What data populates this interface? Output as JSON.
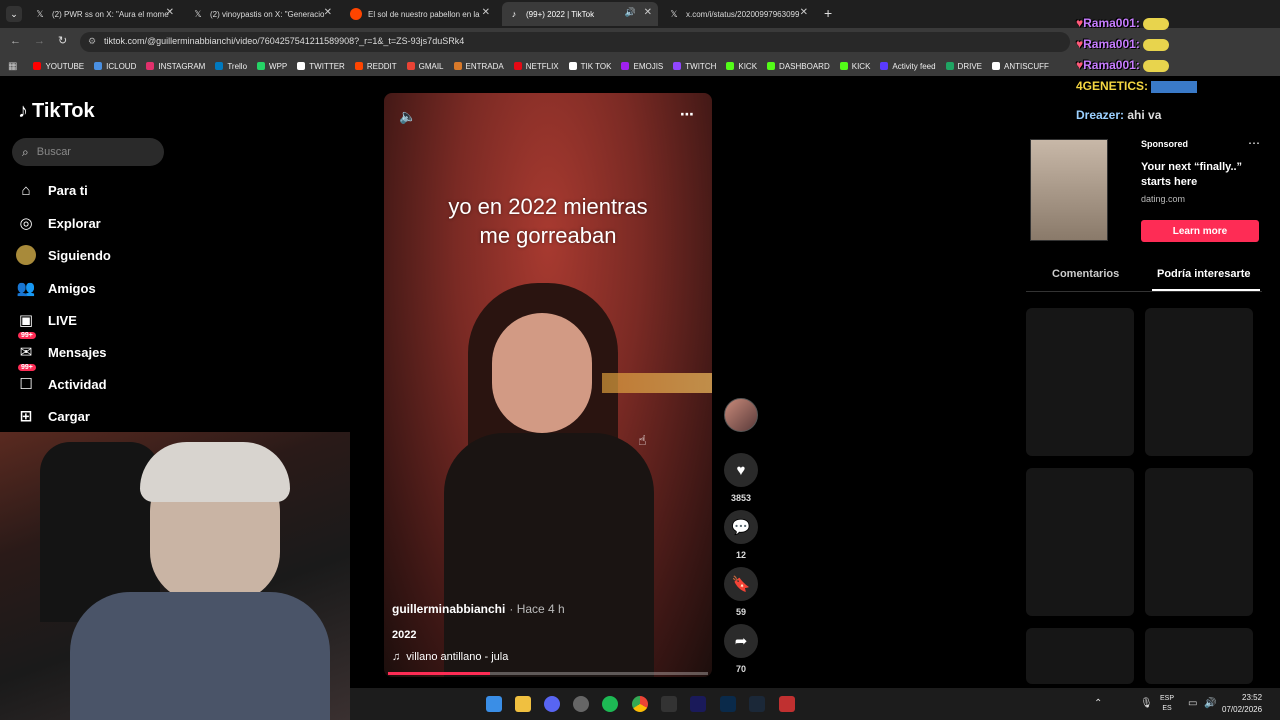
{
  "browser": {
    "tabs": [
      {
        "title": "(2) PWR ss on X: \"Aura el mome",
        "icon": "x-icon"
      },
      {
        "title": "(2) vinoypastis on X: \"Generacio",
        "icon": "x-icon"
      },
      {
        "title": "El sol de nuestro pabellon en la",
        "icon": "reddit-icon"
      },
      {
        "title": "(99+) 2022 | TikTok",
        "icon": "tiktok-icon"
      },
      {
        "title": "x.com/i/status/20200997963099",
        "icon": "x-icon"
      }
    ],
    "url": "tiktok.com/@guillerminabbianchi/video/7604257541211589908?_r=1&_t=ZS-93js7duSRk4",
    "bookmarks": [
      {
        "label": "YOUTUBE",
        "color": "#ff0000"
      },
      {
        "label": "ICLOUD",
        "color": "#4a90e2"
      },
      {
        "label": "INSTAGRAM",
        "color": "#e1306c"
      },
      {
        "label": "Trello",
        "color": "#0079bf"
      },
      {
        "label": "WPP",
        "color": "#25d366"
      },
      {
        "label": "TWITTER",
        "color": "#ffffff"
      },
      {
        "label": "REDDIT",
        "color": "#ff4500"
      },
      {
        "label": "GMAIL",
        "color": "#ea4335"
      },
      {
        "label": "ENTRADA",
        "color": "#d97a2a"
      },
      {
        "label": "NETFLIX",
        "color": "#e50914"
      },
      {
        "label": "TIK TOK",
        "color": "#ffffff"
      },
      {
        "label": "EMOJIS",
        "color": "#a020f0"
      },
      {
        "label": "TWITCH",
        "color": "#9146ff"
      },
      {
        "label": "KICK",
        "color": "#53fc18"
      },
      {
        "label": "DASHBOARD",
        "color": "#53fc18"
      },
      {
        "label": "KICK",
        "color": "#53fc18"
      },
      {
        "label": "Activity feed",
        "color": "#5a3aff"
      },
      {
        "label": "DRIVE",
        "color": "#1fa463"
      },
      {
        "label": "ANTISCUFF",
        "color": "#ffffff"
      }
    ]
  },
  "chat": [
    {
      "user": "Rama001:",
      "color": "#c77dff"
    },
    {
      "user": "Rama001:",
      "color": "#c77dff"
    },
    {
      "user": "Rama001:",
      "color": "#c77dff"
    },
    {
      "user": "4GENETICS:",
      "color": "#f5d742"
    },
    {
      "user": "Dreazer:",
      "color": "#9bd0ff",
      "message": "ahi va"
    }
  ],
  "sidebar": {
    "logo": "TikTok",
    "search_placeholder": "Buscar",
    "badge": "99+",
    "items": [
      {
        "label": "Para ti",
        "icon": "home-icon"
      },
      {
        "label": "Explorar",
        "icon": "compass-icon"
      },
      {
        "label": "Siguiendo",
        "icon": "following-avatar-icon"
      },
      {
        "label": "Amigos",
        "icon": "friends-icon"
      },
      {
        "label": "LIVE",
        "icon": "live-icon"
      },
      {
        "label": "Mensajes",
        "icon": "messages-icon"
      },
      {
        "label": "Actividad",
        "icon": "activity-icon"
      },
      {
        "label": "Cargar",
        "icon": "upload-icon"
      }
    ]
  },
  "video": {
    "caption_line1": "yo en 2022 mientras",
    "caption_line2": "me gorreaban",
    "author": "guillerminabbianchi",
    "time": "· Hace 4 h",
    "description": "2022",
    "music": "villano antillano - jula",
    "progress": 0.32
  },
  "actions": {
    "likes": "3853",
    "comments": "12",
    "saves": "59",
    "shares": "70"
  },
  "ad": {
    "sponsored": "Sponsored",
    "headline": "Your next “finally..” starts here",
    "domain": "dating.com",
    "cta": "Learn more"
  },
  "right_tabs": {
    "comments": "Comentarios",
    "suggested": "Podría interesarte"
  },
  "taskbar": {
    "lang1": "ESP",
    "lang2": "ES",
    "time": "23:52",
    "date": "07/02/2026"
  }
}
